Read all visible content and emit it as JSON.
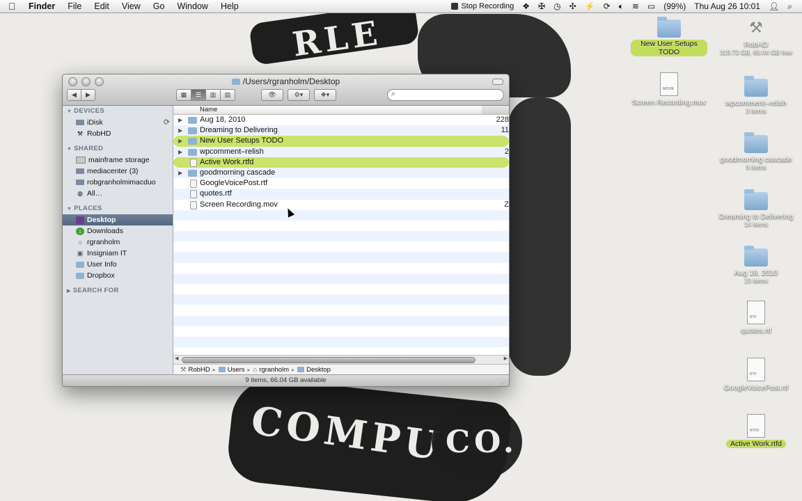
{
  "menubar": {
    "apple": "",
    "app": "Finder",
    "items": [
      "File",
      "Edit",
      "View",
      "Go",
      "Window",
      "Help"
    ],
    "stop_recording": "Stop Recording",
    "battery": "(99%)",
    "clock": "Thu Aug 26  10:01"
  },
  "window": {
    "title": "/Users/rgranholm/Desktop",
    "search_placeholder": "",
    "status": "9 items, 66.04 GB available"
  },
  "sidebar": {
    "devices_header": "DEVICES",
    "devices": [
      "iDisk",
      "RobHD"
    ],
    "shared_header": "SHARED",
    "shared": [
      "mainframe storage",
      "mediacenter (3)",
      "robgranholmimacduo",
      "All…"
    ],
    "places_header": "PLACES",
    "places": [
      "Desktop",
      "Downloads",
      "rgranholm",
      "Insigniam IT",
      "User Info",
      "Dropbox"
    ],
    "search_header": "SEARCH FOR"
  },
  "filelist": {
    "column_name": "Name",
    "rows": [
      {
        "name": "Aug 18, 2010",
        "size": "228"
      },
      {
        "name": "Dreaming to Delivering",
        "size": "11"
      },
      {
        "name": "New User Setups TODO",
        "size": ""
      },
      {
        "name": "wpcomment–relish",
        "size": "2"
      },
      {
        "name": "Active Work.rtfd",
        "size": ""
      },
      {
        "name": "goodmorning cascade",
        "size": ""
      },
      {
        "name": "GoogleVoicePost.rtf",
        "size": ""
      },
      {
        "name": "quotes.rtf",
        "size": ""
      },
      {
        "name": "Screen Recording.mov",
        "size": "Z"
      }
    ]
  },
  "pathbar": [
    "RobHD",
    "Users",
    "rgranholm",
    "Desktop"
  ],
  "desktop_icons": [
    {
      "label": "New User Setups TODO",
      "sub": ""
    },
    {
      "label": "RobHD",
      "sub": "319.73 GB, 66.04 GB free"
    },
    {
      "label": "Screen Recording.mov",
      "sub": ""
    },
    {
      "label": "wpcomment–relish",
      "sub": "3 items"
    },
    {
      "label": "goodmorning cascade",
      "sub": "9 items"
    },
    {
      "label": "Dreaming to Delivering",
      "sub": "14 items"
    },
    {
      "label": "Aug 18, 2010",
      "sub": "10 items"
    },
    {
      "label": "quotes.rtf",
      "sub": ""
    },
    {
      "label": "GoogleVoicePost.rtf",
      "sub": ""
    },
    {
      "label": "Active Work.rtfd",
      "sub": ""
    }
  ],
  "colors": {
    "label_green": "#cbe36b",
    "sidebar_selected": "#5f7290",
    "folder_blue": "#8eb2d4"
  }
}
